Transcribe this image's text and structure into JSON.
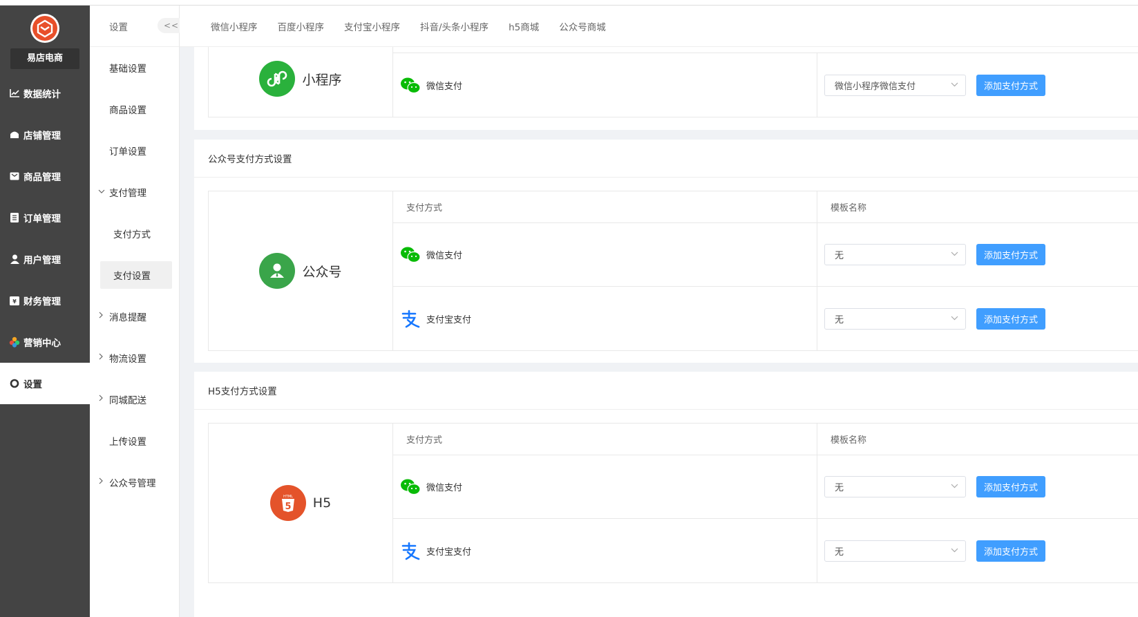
{
  "brand": {
    "name": "易店电商"
  },
  "nav": [
    {
      "label": "数据统计",
      "icon": "chart-line-icon"
    },
    {
      "label": "店铺管理",
      "icon": "shop-icon"
    },
    {
      "label": "商品管理",
      "icon": "goods-icon"
    },
    {
      "label": "订单管理",
      "icon": "order-icon"
    },
    {
      "label": "用户管理",
      "icon": "user-icon"
    },
    {
      "label": "财务管理",
      "icon": "finance-icon"
    },
    {
      "label": "营销中心",
      "icon": "marketing-icon"
    },
    {
      "label": "设置",
      "icon": "gear-icon",
      "active": true
    }
  ],
  "submenu": {
    "title": "设置",
    "collapse_label": "<<",
    "items": [
      {
        "label": "基础设置"
      },
      {
        "label": "商品设置"
      },
      {
        "label": "订单设置"
      },
      {
        "label": "支付管理",
        "expanded": true
      },
      {
        "label": "支付方式"
      },
      {
        "label": "支付设置",
        "selected": true
      },
      {
        "label": "消息提醒"
      },
      {
        "label": "物流设置"
      },
      {
        "label": "同城配送"
      },
      {
        "label": "上传设置"
      },
      {
        "label": "公众号管理"
      }
    ]
  },
  "tabs": [
    "微信小程序",
    "百度小程序",
    "支付宝小程序",
    "抖音/头条小程序",
    "h5商城",
    "公众号商城"
  ],
  "colors": {
    "primary_button": "#409eff",
    "wechat_green": "#09bb07",
    "alipay_blue": "#1677ff",
    "miniprogram_green": "#2ab13c",
    "official_green": "#3aa54a",
    "h5_orange": "#e4532a"
  },
  "sections": {
    "miniprogram": {
      "platform": "小程序",
      "rows": [
        {
          "method": "微信支付",
          "select": "微信小程序微信支付",
          "button": "添加支付方式"
        }
      ]
    },
    "official": {
      "title": "公众号支付方式设置",
      "platform": "公众号",
      "header": {
        "method": "支付方式",
        "template": "模板名称"
      },
      "rows": [
        {
          "method": "微信支付",
          "select": "无",
          "button": "添加支付方式"
        },
        {
          "method": "支付宝支付",
          "select": "无",
          "button": "添加支付方式"
        }
      ]
    },
    "h5": {
      "title": "H5支付方式设置",
      "platform": "H5",
      "header": {
        "method": "支付方式",
        "template": "模板名称"
      },
      "rows": [
        {
          "method": "微信支付",
          "select": "无",
          "button": "添加支付方式"
        },
        {
          "method": "支付宝支付",
          "select": "无",
          "button": "添加支付方式"
        }
      ]
    }
  }
}
